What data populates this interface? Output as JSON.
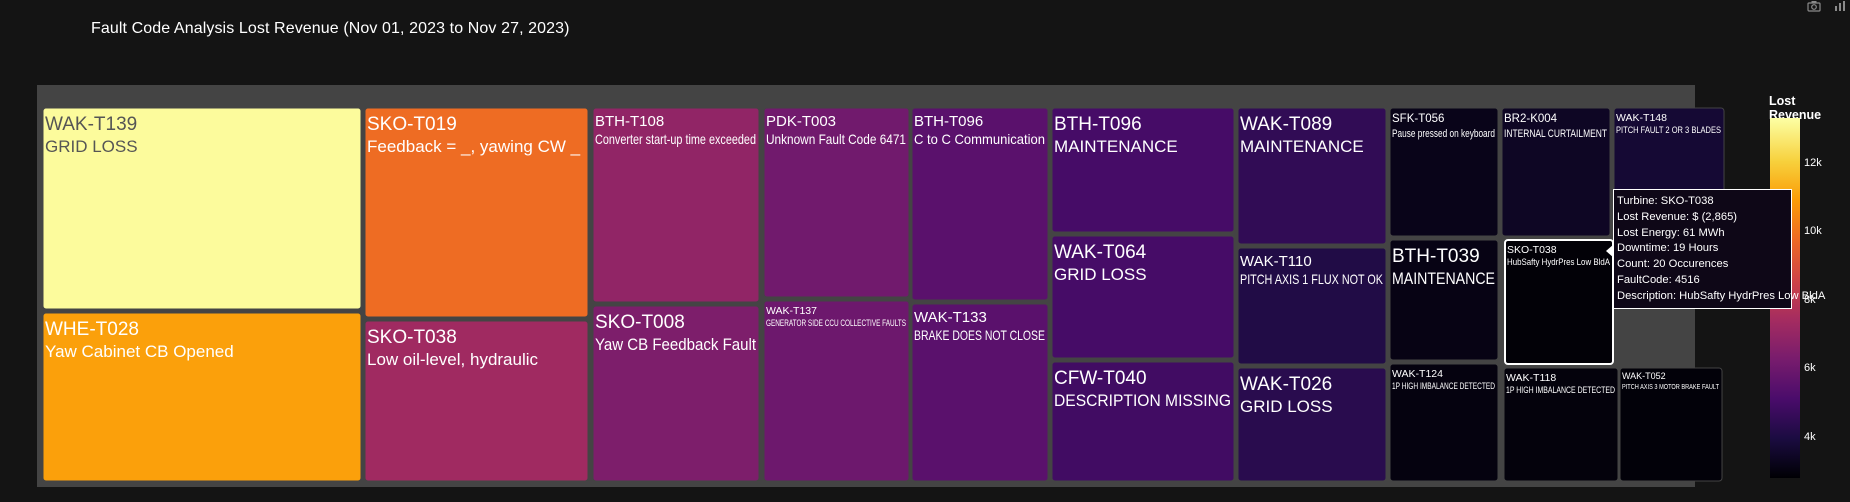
{
  "header": {
    "title": "Fault Code Analysis Lost Revenue (Nov 01, 2023 to Nov 27, 2023)"
  },
  "toolbar": {
    "icons": [
      "camera-icon",
      "bar-chart-icon"
    ]
  },
  "chart_data": {
    "type": "treemap",
    "title": "Fault Code Analysis Lost Revenue (Nov 01, 2023 to Nov 27, 2023)",
    "color_metric": "Lost Revenue",
    "colorscale": "inferno",
    "colorbar": {
      "title": "Lost Revenue",
      "ticks": [
        {
          "value": 4000,
          "label": "4k"
        },
        {
          "value": 6000,
          "label": "6k"
        },
        {
          "value": 8000,
          "label": "8k"
        },
        {
          "value": 10000,
          "label": "10k"
        },
        {
          "value": 12000,
          "label": "12k"
        }
      ],
      "range": [
        2800,
        13300
      ]
    },
    "tiles": [
      {
        "turbine": "WAK-T139",
        "description": "GRID LOSS",
        "lost_revenue": 13200,
        "text_size": "large"
      },
      {
        "turbine": "WHE-T028",
        "description": "Yaw Cabinet CB Opened",
        "lost_revenue": 11000,
        "text_size": "large"
      },
      {
        "turbine": "SKO-T019",
        "description": "Feedback = _, yawing CW _",
        "lost_revenue": 9800,
        "text_size": "large"
      },
      {
        "turbine": "SKO-T038",
        "description": "Low oil-level, hydraulic",
        "lost_revenue": 7300,
        "text_size": "large"
      },
      {
        "turbine": "BTH-T108",
        "description": "Converter start-up time exceeded",
        "lost_revenue": 6900,
        "text_size": "medium"
      },
      {
        "turbine": "SKO-T008",
        "description": "Yaw CB Feedback Fault",
        "lost_revenue": 6400,
        "text_size": "large"
      },
      {
        "turbine": "PDK-T003",
        "description": "Unknown Fault Code 6471",
        "lost_revenue": 6100,
        "text_size": "medium"
      },
      {
        "turbine": "WAK-T137",
        "description": "GENERATOR SIDE CCU COLLECTIVE FAULTS",
        "lost_revenue": 6000,
        "text_size": "tiny"
      },
      {
        "turbine": "BTH-T096",
        "description": "C to C Communication",
        "lost_revenue": 5500,
        "text_size": "medium"
      },
      {
        "turbine": "WAK-T133",
        "description": "BRAKE DOES NOT CLOSE",
        "lost_revenue": 5500,
        "text_size": "medium"
      },
      {
        "turbine": "BTH-T096",
        "description": "MAINTENANCE",
        "lost_revenue": 5000,
        "text_size": "large"
      },
      {
        "turbine": "WAK-T064",
        "description": "GRID LOSS",
        "lost_revenue": 5000,
        "text_size": "large"
      },
      {
        "turbine": "CFW-T040",
        "description": "DESCRIPTION MISSING",
        "lost_revenue": 4900,
        "text_size": "large"
      },
      {
        "turbine": "WAK-T089",
        "description": "MAINTENANCE",
        "lost_revenue": 4500,
        "text_size": "large"
      },
      {
        "turbine": "WAK-T110",
        "description": "PITCH AXIS 1 FLUX NOT OK",
        "lost_revenue": 4100,
        "text_size": "medium"
      },
      {
        "turbine": "WAK-T026",
        "description": "GRID LOSS",
        "lost_revenue": 4300,
        "text_size": "large"
      },
      {
        "turbine": "SFK-T056",
        "description": "Pause pressed on keyboard",
        "lost_revenue": 3200,
        "text_size": "small"
      },
      {
        "turbine": "BR2-K004",
        "description": "INTERNAL CURTAILMENT",
        "lost_revenue": 3400,
        "text_size": "small"
      },
      {
        "turbine": "WAK-T148",
        "description": "PITCH FAULT 2 OR 3 BLADES",
        "lost_revenue": 3700,
        "text_size": "tiny"
      },
      {
        "turbine": "BTH-T039",
        "description": "MAINTENANCE",
        "lost_revenue": 3100,
        "text_size": "large"
      },
      {
        "turbine": "SKO-T038",
        "description": "HubSafty HydrPres Low BldA",
        "lost_revenue": 2865,
        "text_size": "tiny",
        "hovered": true
      },
      {
        "turbine": "WAK-T124",
        "description": "1P HIGH IMBALANCE DETECTED",
        "lost_revenue": 3000,
        "text_size": "tiny"
      },
      {
        "turbine": "WAK-T118",
        "description": "1P HIGH IMBALANCE DETECTED",
        "lost_revenue": 2950,
        "text_size": "tiny"
      },
      {
        "turbine": "WAK-T052",
        "description": "PITCH AXIS 3 MOTOR BRAKE FAULT",
        "lost_revenue": 2900,
        "text_size": "micro"
      }
    ],
    "hover": {
      "turbine_line": "Turbine: SKO-T038",
      "revenue_line": "Lost Revenue: $ (2,865)",
      "energy_line": "Lost Energy: 61 MWh",
      "downtime_line": "Downtime: 19 Hours",
      "count_line": "Count: 20 Occurences",
      "faultcode_line": "FaultCode: 4516",
      "description_line": "Description: HubSafty HydrPres Low BldA"
    }
  }
}
